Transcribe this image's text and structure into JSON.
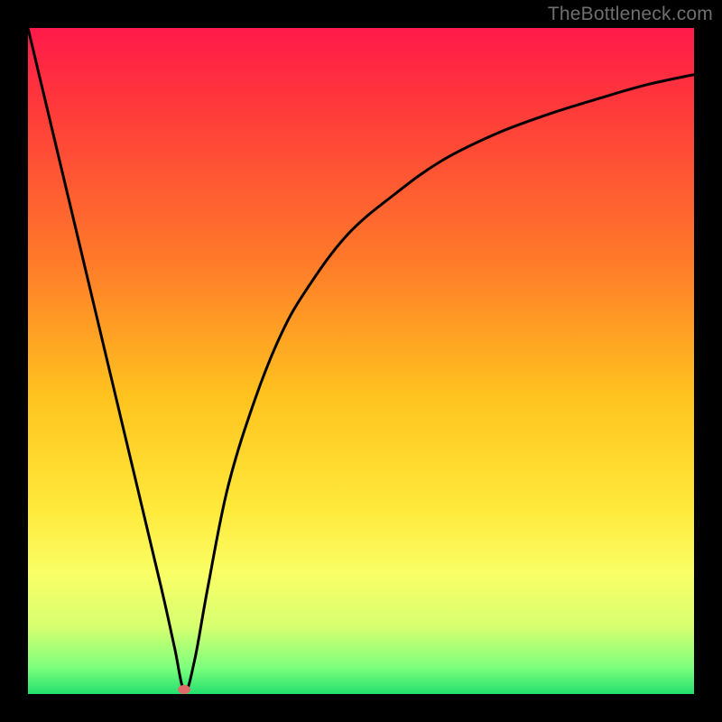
{
  "watermark": {
    "text": "TheBottleneck.com"
  },
  "chart_data": {
    "type": "line",
    "title": "",
    "xlabel": "",
    "ylabel": "",
    "xlim": [
      0,
      100
    ],
    "ylim": [
      0,
      100
    ],
    "grid": false,
    "legend": false,
    "gradient_stops": [
      {
        "pct": 0,
        "color": "#ff1a4a"
      },
      {
        "pct": 12,
        "color": "#ff3a3a"
      },
      {
        "pct": 35,
        "color": "#ff7a2a"
      },
      {
        "pct": 55,
        "color": "#ffc21e"
      },
      {
        "pct": 72,
        "color": "#ffe93a"
      },
      {
        "pct": 82,
        "color": "#faff66"
      },
      {
        "pct": 90,
        "color": "#d6ff70"
      },
      {
        "pct": 96,
        "color": "#7dff7d"
      },
      {
        "pct": 100,
        "color": "#23e06e"
      }
    ],
    "series": [
      {
        "name": "bottleneck-curve",
        "x": [
          0,
          5,
          10,
          15,
          20,
          22,
          23.5,
          25,
          27,
          30,
          34,
          38,
          42,
          48,
          55,
          62,
          70,
          78,
          86,
          93,
          100
        ],
        "y": [
          100,
          79,
          58,
          37,
          16,
          7,
          0.5,
          5,
          16,
          31,
          44,
          54,
          61,
          69,
          75,
          80,
          84,
          87,
          89.5,
          91.5,
          93
        ]
      }
    ],
    "marker": {
      "x_pct": 23.4,
      "y_pct_from_top": 99.3,
      "color": "#e06a6a"
    }
  }
}
